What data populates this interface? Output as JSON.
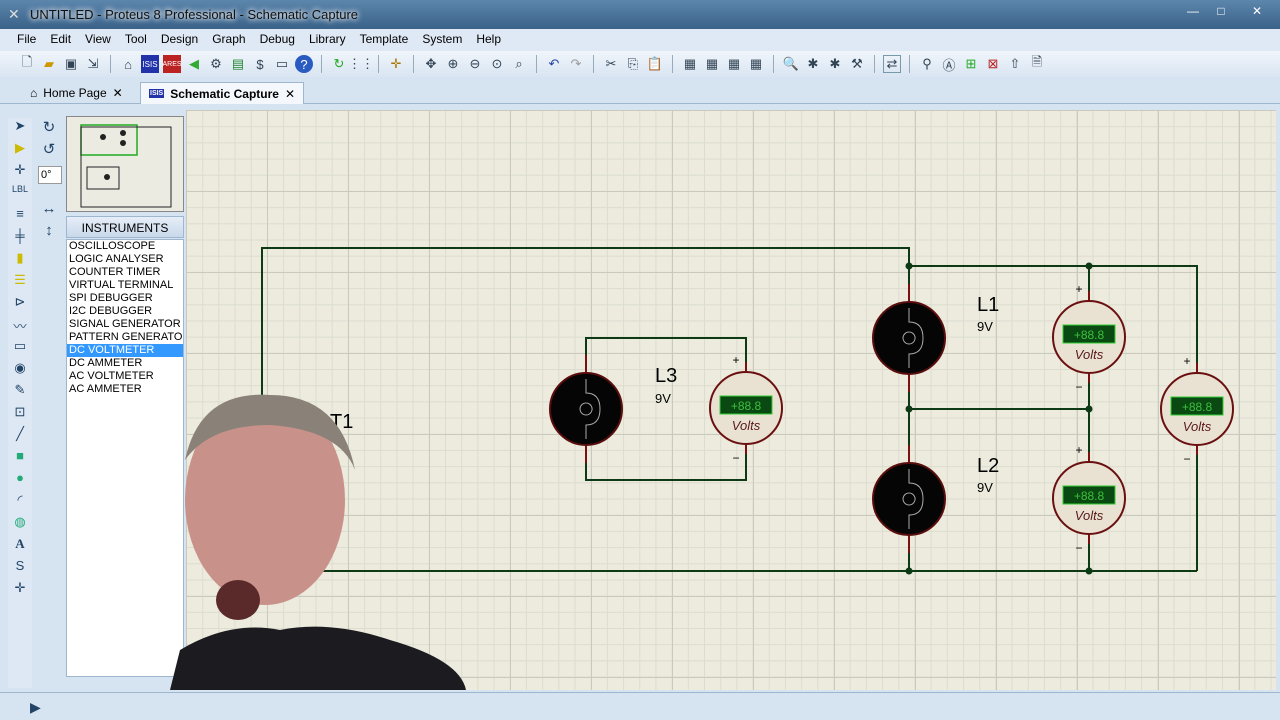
{
  "window": {
    "title": "UNTITLED - Proteus 8 Professional - Schematic Capture"
  },
  "menu": [
    "File",
    "Edit",
    "View",
    "Tool",
    "Design",
    "Graph",
    "Debug",
    "Library",
    "Template",
    "System",
    "Help"
  ],
  "tabs": [
    {
      "label": "Home Page",
      "close": "✕"
    },
    {
      "label": "Schematic Capture",
      "close": "✕"
    }
  ],
  "rotation": {
    "angle": "0°"
  },
  "instruments": {
    "header": "INSTRUMENTS",
    "selected": "DC VOLTMETER",
    "items": [
      "OSCILLOSCOPE",
      "LOGIC ANALYSER",
      "COUNTER TIMER",
      "VIRTUAL TERMINAL",
      "SPI DEBUGGER",
      "I2C DEBUGGER",
      "SIGNAL GENERATOR",
      "PATTERN GENERATO",
      "DC VOLTMETER",
      "DC AMMETER",
      "AC VOLTMETER",
      "AC AMMETER"
    ]
  },
  "schematic": {
    "lamps": [
      {
        "ref": "L1",
        "value": "9V"
      },
      {
        "ref": "L2",
        "value": "9V"
      },
      {
        "ref": "L3",
        "value": "9V"
      }
    ],
    "battery_ref_partial": "T1",
    "meter_display": "+88.8",
    "meter_unit": "Volts",
    "plus": "+",
    "minus": "−"
  },
  "colors": {
    "wire": "#0d3a14",
    "component": "#7a1010",
    "lcd": "#0a4a12",
    "lcd_text": "#3fbf3f",
    "selection": "#3399ff"
  }
}
